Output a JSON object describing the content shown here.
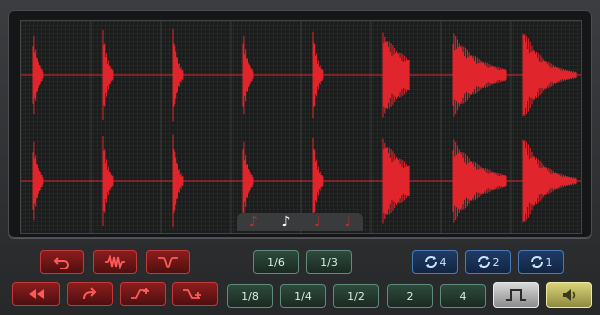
{
  "colors": {
    "waveform": "#e0262c",
    "accent_red": "#c23a3a",
    "accent_green": "#5f8c78",
    "accent_blue": "#4b79b8"
  },
  "waveform": {
    "channels": 2,
    "slices": 8
  },
  "note_values": {
    "items": [
      "♪",
      "♪",
      "♩",
      "♩"
    ],
    "selected_index": 1
  },
  "left_controls": {
    "row1": [
      {
        "name": "undo-button",
        "icon": "undo-icon"
      },
      {
        "name": "wave-shape-button",
        "icon": "wave-icon"
      },
      {
        "name": "filter-dip-button",
        "icon": "dip-curve-icon"
      }
    ],
    "row2": [
      {
        "name": "rewind-button",
        "icon": "rewind-icon"
      },
      {
        "name": "redo-button",
        "icon": "redo-icon"
      },
      {
        "name": "fade-in-button",
        "icon": "fade-in-icon"
      },
      {
        "name": "fade-out-button",
        "icon": "fade-out-icon"
      }
    ]
  },
  "divisions": {
    "row1": [
      "1/6",
      "1/3"
    ],
    "row2": [
      "1/8",
      "1/4",
      "1/2",
      "2",
      "4"
    ]
  },
  "repeat": {
    "labels": [
      "4",
      "2",
      "1"
    ]
  },
  "extra": {
    "gate_icon": "square-pulse-icon",
    "speaker_icon": "speaker-icon"
  }
}
